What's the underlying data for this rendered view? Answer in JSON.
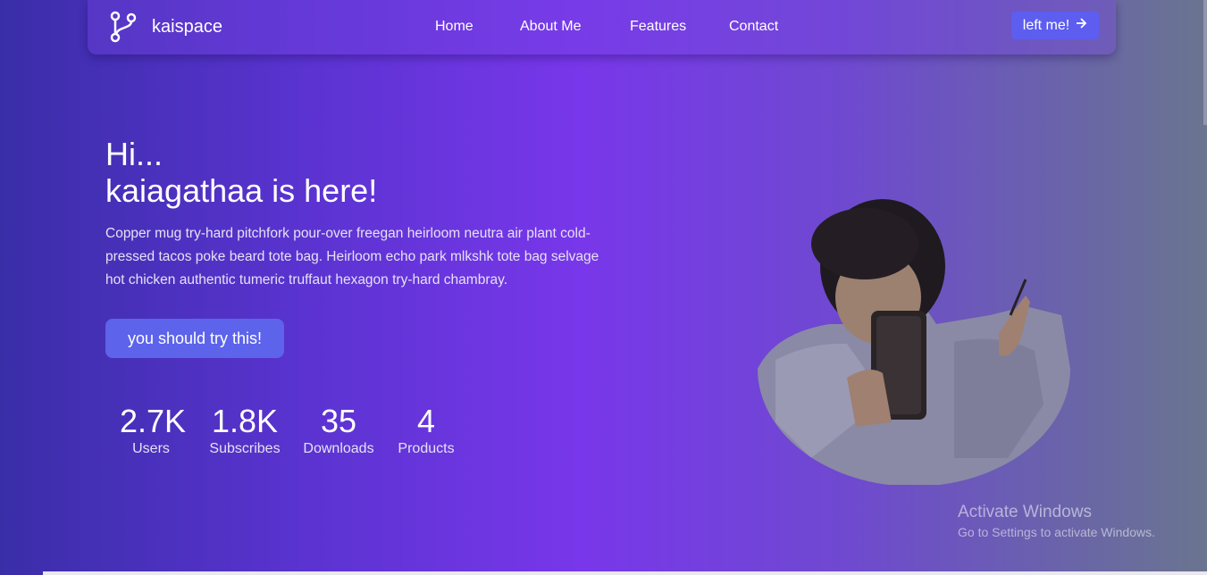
{
  "nav": {
    "brand": "kaispace",
    "links": [
      {
        "label": "Home"
      },
      {
        "label": "About Me"
      },
      {
        "label": "Features"
      },
      {
        "label": "Contact"
      }
    ],
    "cta_label": "left me!",
    "cta_icon": "arrow-right-icon"
  },
  "hero": {
    "greeting": "Hi...",
    "title": "kaiagathaa is here!",
    "description": "Copper mug try-hard pitchfork pour-over freegan heirloom neutra air plant cold-pressed tacos poke beard tote bag. Heirloom echo park mlkshk tote bag selvage hot chicken authentic tumeric truffaut hexagon try-hard chambray.",
    "button_label": "you should try this!"
  },
  "stats": [
    {
      "value": "2.7K",
      "label": "Users"
    },
    {
      "value": "1.8K",
      "label": "Subscribes"
    },
    {
      "value": "35",
      "label": "Downloads"
    },
    {
      "value": "4",
      "label": "Products"
    }
  ],
  "watermark": {
    "title": "Activate Windows",
    "subtitle": "Go to Settings to activate Windows."
  },
  "colors": {
    "accent": "#5d63ea",
    "gradient_start": "#3a2ea8",
    "gradient_mid": "#7837ea",
    "gradient_end": "#6a7590"
  }
}
